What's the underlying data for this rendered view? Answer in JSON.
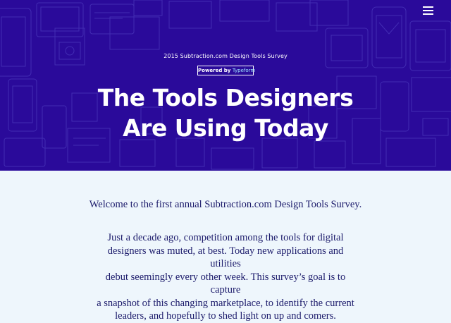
{
  "colors": {
    "hero_background": "#2a0a9a",
    "hero_pattern_stroke": "#4a38bc",
    "page_background": "#eef6fc",
    "body_text": "#1c1b6b",
    "powered_brand": "#9fe6ff"
  },
  "header": {
    "menu_icon": "hamburger-menu-icon"
  },
  "hero": {
    "eyebrow": "2015 Subtraction.com Design Tools Survey",
    "powered_by_label": "Powered by",
    "powered_by_brand": "Typeform",
    "title_line_1": "The Tools Designers",
    "title_line_2": "Are Using Today"
  },
  "content": {
    "intro": "Welcome to the first annual Subtraction.com Design Tools Survey.",
    "paragraph_lines": [
      "Just a decade ago, competition among the tools for digital",
      "designers was muted, at best. Today new applications and utilities",
      "debut seemingly every other week. This survey’s goal is to capture",
      "a snapshot of this changing marketplace, to identify the current",
      "leaders, and hopefully to shed light on up and comers."
    ]
  }
}
